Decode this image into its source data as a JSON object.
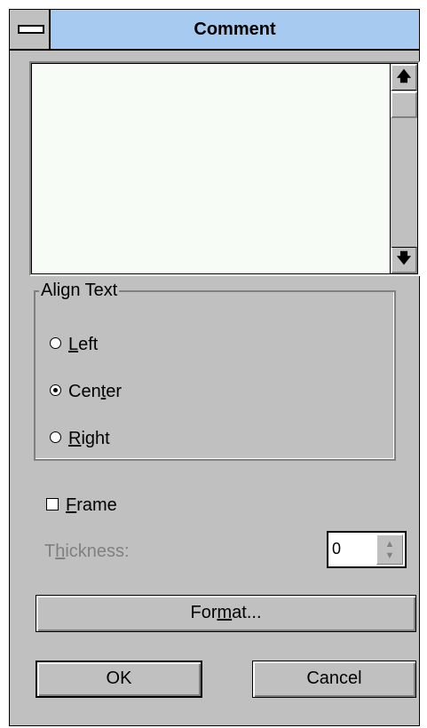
{
  "titlebar": {
    "title": "Comment"
  },
  "align_group": {
    "legend": "Align Text",
    "options": [
      {
        "label_pre": "",
        "mnemonic": "L",
        "label_post": "eft",
        "selected": false
      },
      {
        "label_pre": "Cen",
        "mnemonic": "t",
        "label_post": "er",
        "selected": true
      },
      {
        "label_pre": "",
        "mnemonic": "R",
        "label_post": "ight",
        "selected": false
      }
    ]
  },
  "frame": {
    "label_pre": "",
    "mnemonic": "F",
    "label_post": "rame",
    "checked": false
  },
  "thickness": {
    "label_pre": "T",
    "mnemonic": "h",
    "label_post": "ickness:",
    "value": "0"
  },
  "buttons": {
    "format": {
      "pre": "For",
      "mnemonic": "m",
      "post": "at..."
    },
    "ok": "OK",
    "cancel": "Cancel"
  },
  "icons": {
    "scroll_up": "arrow-up-icon",
    "scroll_down": "arrow-down-icon",
    "system_menu": "system-menu-icon"
  }
}
